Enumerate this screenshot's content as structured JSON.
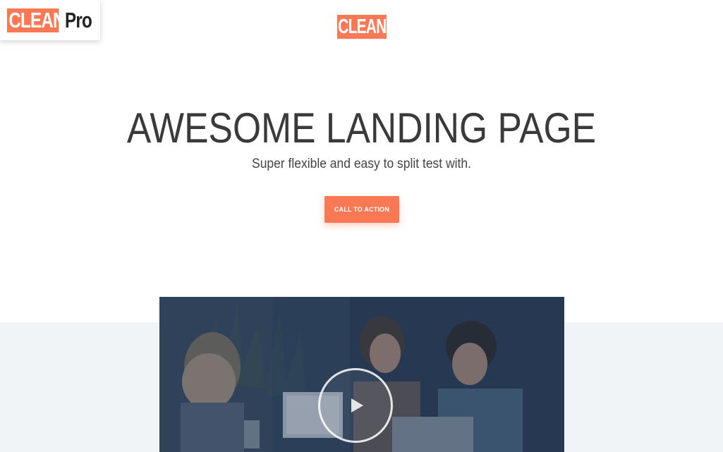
{
  "badge": {
    "brand_word": "CLEAN",
    "suffix": "Pro"
  },
  "header": {
    "logo_text": "CLEAN"
  },
  "hero": {
    "headline": "AWESOME LANDING PAGE",
    "subheadline": "Super flexible and easy to split test with.",
    "cta_label": "CALL TO ACTION"
  },
  "video": {
    "play_icon": "play-icon"
  },
  "colors": {
    "accent": "#fa7954",
    "headline_text": "#3a3a3a",
    "lower_band": "#f1f4f7"
  }
}
